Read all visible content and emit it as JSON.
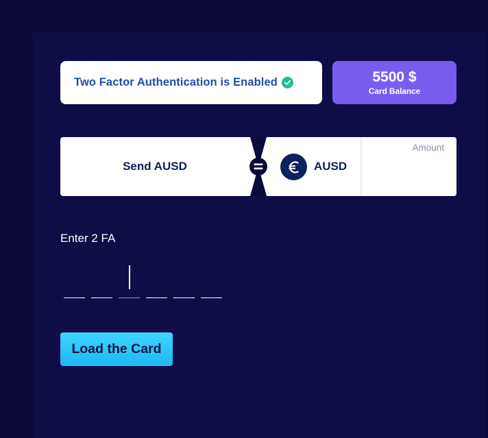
{
  "security": {
    "twofa_message": "Two Factor Authentication is Enabled",
    "status_icon": "check-circle-icon",
    "status_color": "#1fbf8f"
  },
  "balance": {
    "amount": "5500 $",
    "label": "Card Balance",
    "color": "#7b5cf0"
  },
  "transfer": {
    "send_label": "Send AUSD",
    "currency_icon": "euro-icon",
    "currency": "AUSD",
    "amount_placeholder": "Amount",
    "amount_value": ""
  },
  "twofa_input": {
    "label": "Enter 2 FA",
    "digits": 6,
    "active_index": 2
  },
  "actions": {
    "load_button_label": "Load the Card"
  },
  "colors": {
    "background": "#0b0a3a",
    "panel": "#0e0d47",
    "accent": "#36b8f0"
  }
}
